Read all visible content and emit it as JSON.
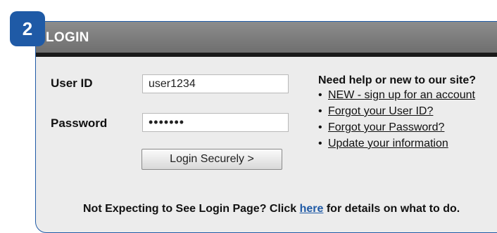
{
  "step_badge": "2",
  "header": {
    "title": "LOGIN"
  },
  "form": {
    "user_id": {
      "label": "User ID",
      "value": "user1234"
    },
    "password": {
      "label": "Password",
      "value": "•••••••"
    },
    "submit_label": "Login Securely >"
  },
  "help": {
    "title": "Need help or new to our site?",
    "bullet": "•",
    "links": [
      "NEW - sign up for an account",
      "Forgot your User ID?",
      "Forgot your Password?",
      "Update your information"
    ]
  },
  "footer": {
    "text_before": "Not Expecting to See Login Page? Click ",
    "link": "here",
    "text_after": " for details on what to do."
  },
  "colors": {
    "accent": "#1f5aa6",
    "header_gray": "#7d7d7d",
    "panel_bg": "#ececec"
  }
}
